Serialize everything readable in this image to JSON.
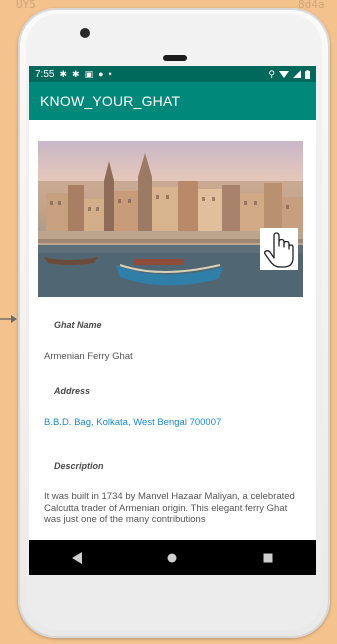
{
  "background": {
    "left_fragment": "UY5",
    "right_fragment": "8d4a"
  },
  "status_bar": {
    "time": "7:55"
  },
  "app_bar": {
    "title": "KNOW_YOUR_GHAT"
  },
  "details": {
    "ghat_name_label": "Ghat Name",
    "ghat_name_value": "Armenian Ferry Ghat",
    "address_label": "Address",
    "address_value": "B.B.D. Bag, Kolkata, West Bengal 700007",
    "description_label": "Description",
    "description_value": "It was built in 1734 by Manvel Hazaar Maliyan, a celebrated Calcutta trader of Armenian origin. This elegant ferry Ghat was just one of the many contributions"
  },
  "colors": {
    "app_bar": "#00897b",
    "status_bar": "#00695c",
    "link": "#1e88c8",
    "page_background": "#f4c38d"
  }
}
